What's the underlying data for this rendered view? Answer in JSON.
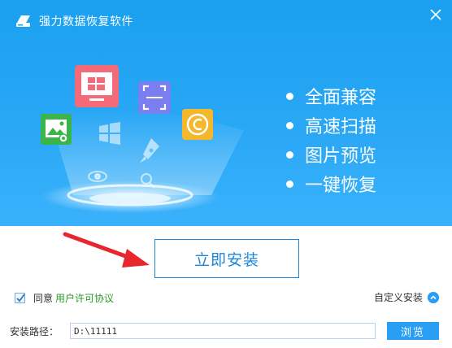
{
  "window": {
    "title": "强力数据恢复软件",
    "accent": "#2a9df4"
  },
  "hero": {
    "features": [
      "全面兼容",
      "高速扫描",
      "图片预览",
      "一键恢复"
    ],
    "icons": [
      "image-icon",
      "windows-monitor-icon",
      "scan-frame-icon",
      "copyright-icon",
      "windows-logo-icon",
      "rocket-icon",
      "eye-icon",
      "magnifier-icon"
    ]
  },
  "install": {
    "label": "立即安装"
  },
  "agreement": {
    "checked": true,
    "prefix": "同意",
    "link": "用户许可协议"
  },
  "custom_install": {
    "label": "自定义安装"
  },
  "path": {
    "label": "安装路径：",
    "value": "D:\\11111"
  },
  "browse": {
    "label": "浏览"
  }
}
